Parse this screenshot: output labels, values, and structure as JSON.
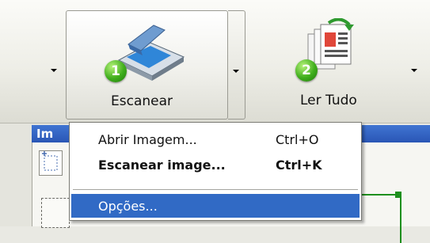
{
  "toolbar": {
    "scan_button": {
      "label": "Escanear",
      "badge": "1",
      "icon": "scanner-icon"
    },
    "read_all_button": {
      "label": "Ler Tudo",
      "badge": "2",
      "icon": "document-stack-icon"
    }
  },
  "panel": {
    "title": "Im"
  },
  "context_menu": {
    "items": [
      {
        "label": "Abrir Imagem...",
        "shortcut": "Ctrl+O",
        "bold": false,
        "selected": false
      },
      {
        "label": "Escanear image...",
        "shortcut": "Ctrl+K",
        "bold": true,
        "selected": false
      },
      {
        "label": "Opções...",
        "shortcut": "",
        "bold": false,
        "selected": true
      }
    ]
  },
  "colors": {
    "accent": "#316ac5",
    "panel_title": "#2a56b5",
    "badge_green": "#3fae1c"
  }
}
